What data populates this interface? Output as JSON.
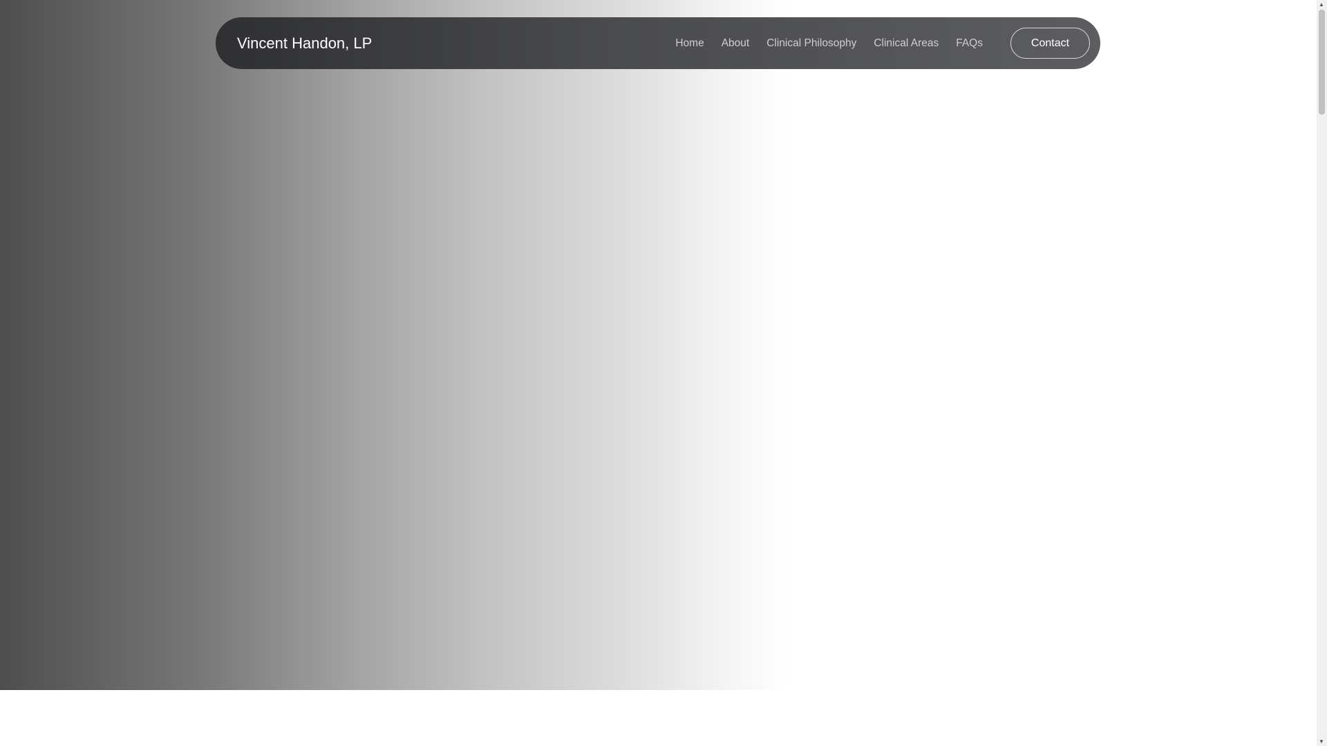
{
  "brand": "Vincent Handon, LP",
  "nav": {
    "items": [
      "Home",
      "About",
      "Clinical Philosophy",
      "Clinical Areas",
      "FAQs"
    ],
    "contact": "Contact"
  },
  "scrollbar": {
    "up": "▲",
    "down": "▼"
  }
}
